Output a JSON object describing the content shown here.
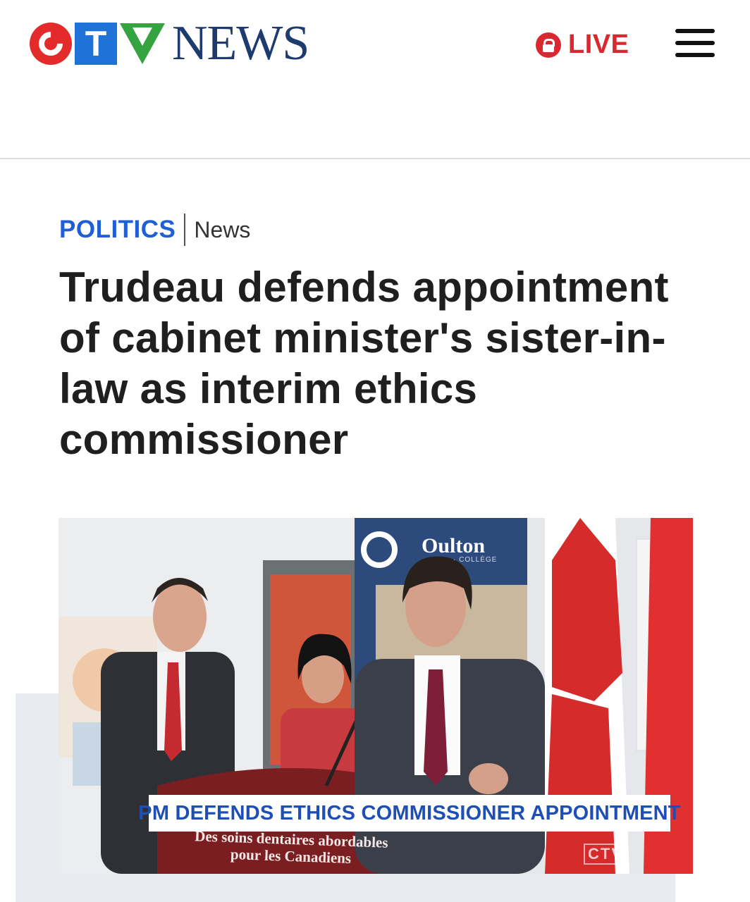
{
  "header": {
    "logo_letters": "CTV",
    "logo_word": "NEWS",
    "live_label": "LIVE",
    "colors": {
      "logo_red": "#e32b2b",
      "logo_blue": "#1f73d8",
      "logo_green": "#35a33f",
      "news_navy": "#1d3b6e",
      "live_red": "#d9282f"
    }
  },
  "breadcrumb": {
    "section": "POLITICS",
    "subsection": "News"
  },
  "article": {
    "headline": "Trudeau defends appointment of cabinet minister's sister-in-law as interim ethics commissioner"
  },
  "media": {
    "caption": "PM DEFENDS ETHICS COMMISSIONER APPOINTMENT",
    "podium_line1": "Des soins dentaires abordables",
    "podium_line2": "pour les Canadiens",
    "banner_name": "Oulton",
    "banner_sub": "· COLLÈGE",
    "watermark": "CTV"
  }
}
